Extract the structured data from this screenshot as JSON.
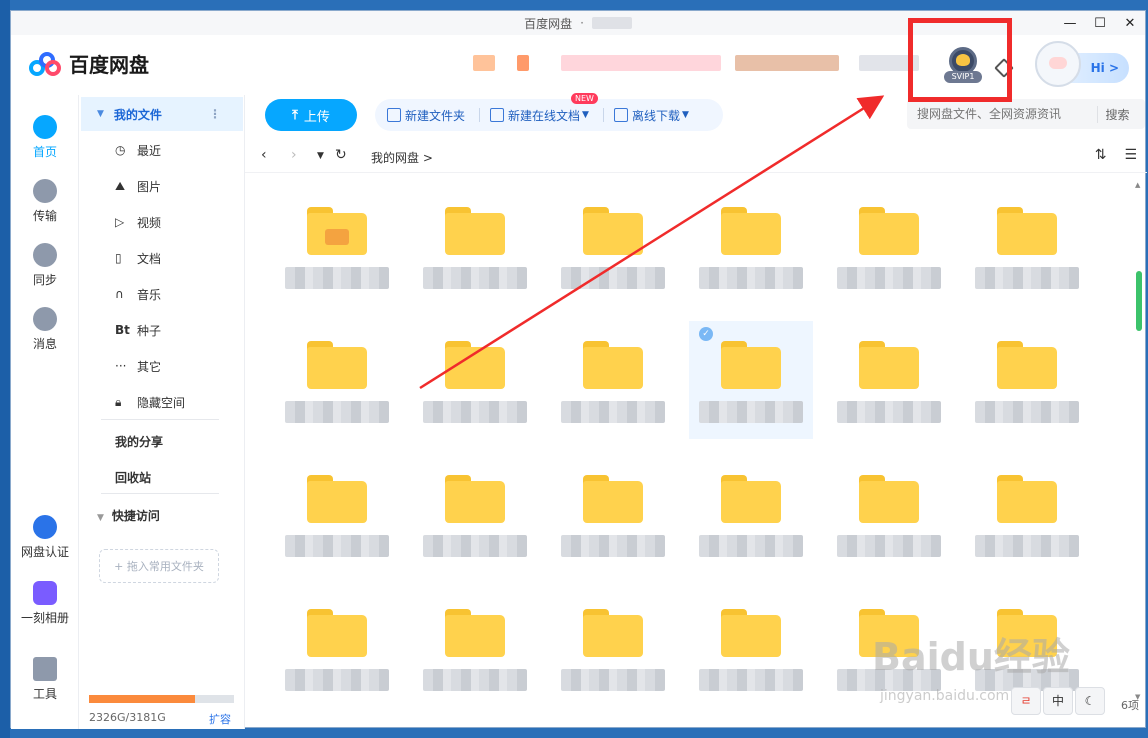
{
  "window": {
    "title": "百度网盘",
    "separator": "·",
    "controls": [
      "—",
      "☐",
      "✕"
    ]
  },
  "header": {
    "logo_text": "百度网盘",
    "vip_label": "SVIP1",
    "hi_label": "Hi >"
  },
  "leftnav": [
    {
      "label": "首页",
      "icon": "cloud-icon",
      "active": true
    },
    {
      "label": "传输",
      "icon": "transfer-icon"
    },
    {
      "label": "同步",
      "icon": "sync-icon"
    },
    {
      "label": "消息",
      "icon": "message-icon"
    },
    {
      "label": "网盘认证",
      "icon": "verify-icon"
    },
    {
      "label": "一刻相册",
      "icon": "album-icon"
    },
    {
      "label": "工具",
      "icon": "tools-icon"
    }
  ],
  "tree": {
    "head": "我的文件",
    "items": [
      {
        "label": "最近",
        "icon": "clock-icon"
      },
      {
        "label": "图片",
        "icon": "image-icon"
      },
      {
        "label": "视频",
        "icon": "video-icon"
      },
      {
        "label": "文档",
        "icon": "doc-icon"
      },
      {
        "label": "音乐",
        "icon": "music-icon"
      },
      {
        "label": "种子",
        "icon": "bt-icon"
      },
      {
        "label": "其它",
        "icon": "more-icon"
      },
      {
        "label": "隐藏空间",
        "icon": "lock-icon"
      }
    ],
    "my_share": "我的分享",
    "recycle": "回收站",
    "quick_access": "快捷访问",
    "drop_hint": "+ 拖入常用文件夹",
    "storage_text": "2326G/3181G",
    "storage_used_fraction": 0.731,
    "expand": "扩容"
  },
  "toolbar": {
    "upload": "上传",
    "new_folder": "新建文件夹",
    "new_online_doc": "新建在线文档",
    "new_badge": "NEW",
    "offline_download": "离线下载",
    "search_placeholder": "搜网盘文件、全网资源资讯",
    "search_btn": "搜索"
  },
  "breadcrumb": {
    "root": "我的网盘",
    "sep": ">"
  },
  "status": {
    "count": "6项"
  },
  "watermark": {
    "brand": "Baidu经验",
    "url": "jingyan.baidu.com"
  }
}
